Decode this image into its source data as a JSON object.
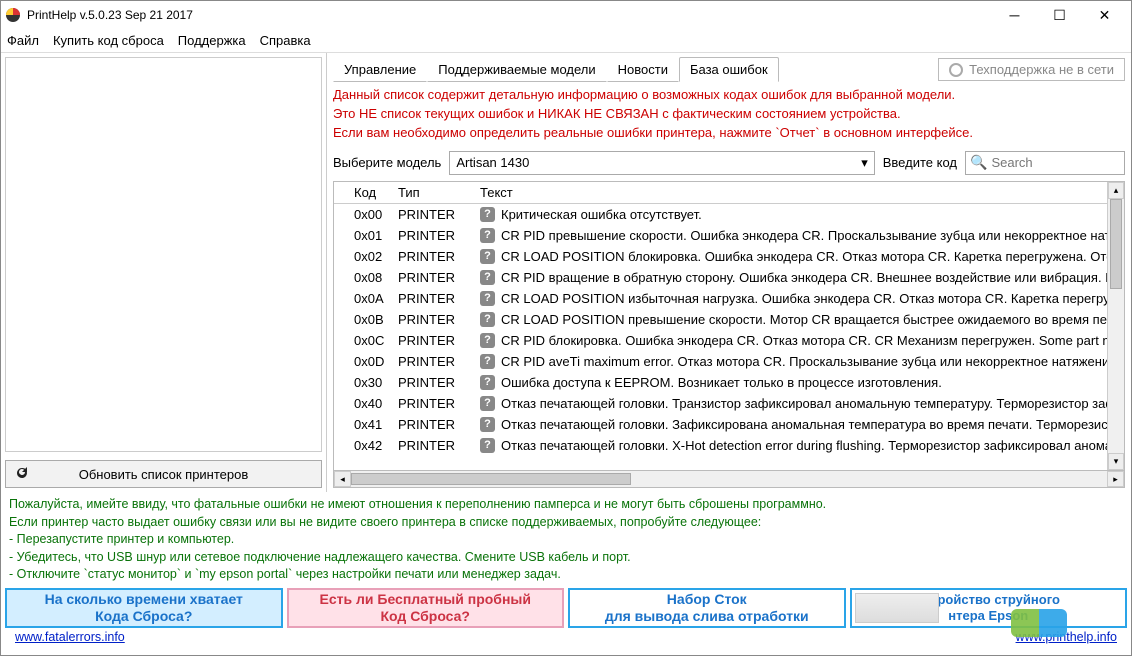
{
  "window": {
    "title": "PrintHelp v.5.0.23 Sep 21 2017"
  },
  "menu": {
    "file": "Файл",
    "buy": "Купить код сброса",
    "support": "Поддержка",
    "help": "Справка"
  },
  "tabs": {
    "t1": "Управление",
    "t2": "Поддерживаемые модели",
    "t3": "Новости",
    "t4": "База ошибок"
  },
  "support_btn": "Техподдержка не в сети",
  "warning": {
    "l1": "Данный список содержит детальную информацию о возможных кодах ошибок для выбранной модели.",
    "l2": "Это НЕ список текущих ошибок и НИКАК НЕ СВЯЗАН с фактическим состоянием устройства.",
    "l3": "Если вам необходимо определить реальные ошибки принтера, нажмите `Отчет` в основном интерфейсе."
  },
  "controls": {
    "model_label": "Выберите модель",
    "model_value": "Artisan 1430",
    "code_label": "Введите код",
    "search_placeholder": "Search"
  },
  "table": {
    "h_code": "Код",
    "h_type": "Тип",
    "h_text": "Текст",
    "rows": [
      {
        "code": "0x00",
        "type": "PRINTER",
        "text": "Критическая ошибка отсутствует."
      },
      {
        "code": "0x01",
        "type": "PRINTER",
        "text": "CR PID превышение скорости. Ошибка энкодера CR. Проскальзывание зубца или некорректное натяжение зубча"
      },
      {
        "code": "0x02",
        "type": "PRINTER",
        "text": "CR LOAD POSITION блокировка. Ошибка энкодера CR. Отказ мотора CR. Каретка перегружена. Отсоединение каб"
      },
      {
        "code": "0x08",
        "type": "PRINTER",
        "text": "CR PID вращение в обратную сторону. Ошибка энкодера CR. Внешнее воздействие или вибрация. Проскальзыван"
      },
      {
        "code": "0x0A",
        "type": "PRINTER",
        "text": "CR LOAD POSITION избыточная нагрузка. Ошибка энкодера CR. Отказ мотора CR. Каретка перегружена. Проскаль"
      },
      {
        "code": "0x0B",
        "type": "PRINTER",
        "text": "CR LOAD POSITION превышение скорости. Мотор CR вращается быстрее ожидаемого во время печати. Ошибка"
      },
      {
        "code": "0x0C",
        "type": "PRINTER",
        "text": "CR PID блокировка. Ошибка энкодера CR. Отказ мотора CR. CR Механизм перегружен. Some part may be detachec"
      },
      {
        "code": "0x0D",
        "type": "PRINTER",
        "text": "CR PID aveTi maximum error. Отказ мотора CR. Проскальзывание зубца или некорректное натяжение зубчатого ре"
      },
      {
        "code": "0x30",
        "type": "PRINTER",
        "text": "Ошибка доступа к EEPROM. Возникает только в процессе изготовления."
      },
      {
        "code": "0x40",
        "type": "PRINTER",
        "text": "Отказ печатающей головки. Транзистор зафиксировал аномальную температуру. Терморезистор зафиксировал"
      },
      {
        "code": "0x41",
        "type": "PRINTER",
        "text": "Отказ печатающей головки. Зафиксирована аномальная температура во время печати. Терморезистор зафиксир"
      },
      {
        "code": "0x42",
        "type": "PRINTER",
        "text": "Отказ печатающей головки. X-Hot detection error during flushing. Терморезистор зафиксировал аномальную тем"
      }
    ]
  },
  "refresh_btn": "Обновить список принтеров",
  "footer": {
    "l1": "Пожалуйста, имейте ввиду, что фатальные ошибки не имеют отношения к переполнению памперса и не могут быть сброшены программно.",
    "l2": "Если принтер часто выдает ошибку связи или вы не видите своего принтера в списке поддерживаемых, попробуйте следующее:",
    "l3": "- Перезапустите принтер и компьютер.",
    "l4": "- Убедитесь, что USB шнур или сетевое подключение надлежащего качества. Смените USB кабель и порт.",
    "l5": "- Отключите `статус монитор` и `my epson portal` через настройки печати или менеджер задач."
  },
  "banners": {
    "b1a": "На сколько времени хватает",
    "b1b": "Кода Сброса?",
    "b2a": "Есть ли Бесплатный пробный",
    "b2b": "Код Сброса?",
    "b3a": "Набор Сток",
    "b3b": "для вывода слива отработки",
    "b4a": "Устройство струйного",
    "b4b": "нтера Epson"
  },
  "links": {
    "left": "www.fatalerrors.info",
    "right": "www.printhelp.info"
  }
}
